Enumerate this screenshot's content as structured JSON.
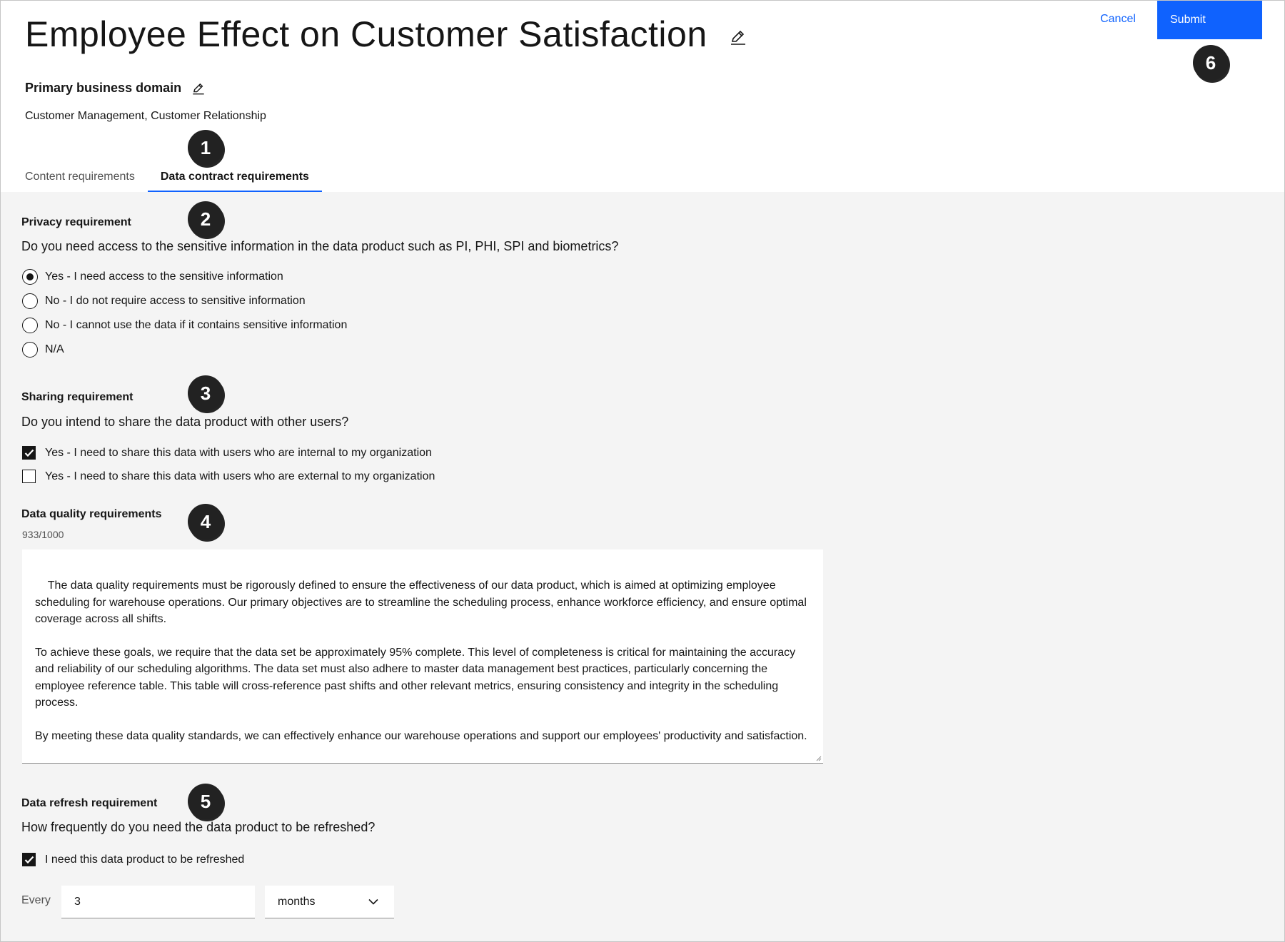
{
  "header": {
    "title": "Employee Effect on Customer Satisfaction",
    "domain_label": "Primary business domain",
    "domain_value": "Customer Management, Customer Relationship",
    "cancel_label": "Cancel",
    "submit_label": "Submit"
  },
  "tabs": [
    {
      "label": "Content requirements",
      "active": false
    },
    {
      "label": "Data contract requirements",
      "active": true
    }
  ],
  "privacy": {
    "label": "Privacy requirement",
    "question": "Do you need access to the sensitive information in the data product such as PI, PHI, SPI and biometrics?",
    "options": [
      {
        "label": "Yes - I need access to the sensitive information",
        "selected": true
      },
      {
        "label": "No - I do not require access to sensitive information",
        "selected": false
      },
      {
        "label": "No - I cannot use the data if it contains sensitive information",
        "selected": false
      },
      {
        "label": "N/A",
        "selected": false
      }
    ]
  },
  "sharing": {
    "label": "Sharing requirement",
    "question": "Do you intend to share the data product with other users?",
    "options": [
      {
        "label": "Yes - I need to share this data with users who are internal to my organization",
        "checked": true
      },
      {
        "label": "Yes - I need to share this data with users who are external to my organization",
        "checked": false
      }
    ]
  },
  "quality": {
    "label": "Data quality requirements",
    "counter": "933/1000",
    "text": "The data quality requirements must be rigorously defined to ensure the effectiveness of our data product, which is aimed at optimizing employee scheduling for warehouse operations. Our primary objectives are to streamline the scheduling process, enhance workforce efficiency, and ensure optimal coverage across all shifts.\n\nTo achieve these goals, we require that the data set be approximately 95% complete. This level of completeness is critical for maintaining the accuracy and reliability of our scheduling algorithms. The data set must also adhere to master data management best practices, particularly concerning the employee reference table. This table will cross-reference past shifts and other relevant metrics, ensuring consistency and integrity in the scheduling process.\n\nBy meeting these data quality standards, we can effectively enhance our warehouse operations and support our employees' productivity and satisfaction."
  },
  "refresh": {
    "label": "Data refresh requirement",
    "question": "How frequently do you need the data product to be refreshed?",
    "checkbox_label": "I need this data product to be refreshed",
    "checked": true,
    "every_label": "Every",
    "every_value": "3",
    "unit_value": "months"
  },
  "badges": [
    "1",
    "2",
    "3",
    "4",
    "5",
    "6"
  ],
  "colors": {
    "accent": "#0f62fe",
    "background": "#f4f4f4",
    "badge": "#222222"
  }
}
